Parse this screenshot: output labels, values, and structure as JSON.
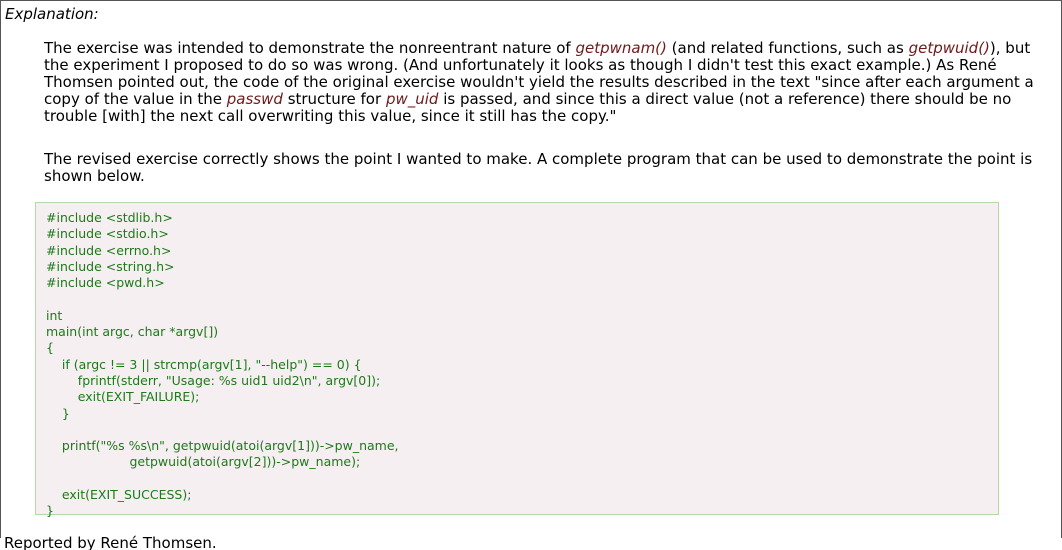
{
  "section_label": "Explanation:",
  "paragraph1": {
    "t1": "The exercise was intended to demonstrate the nonreentrant nature of ",
    "fn1": "getpwnam()",
    "t2": " (and related functions, such as ",
    "fn2": "getpwuid()",
    "t3": "), but the experiment I proposed to do so was wrong. (And unfortunately it looks as though I didn't test this exact example.) As René Thomsen pointed out, the code of the original exercise wouldn't yield the results described in the text \"since after each argument a copy of the value in the ",
    "fn3": "passwd",
    "t4": " structure for ",
    "fn4": "pw_uid",
    "t5": " is passed, and since this a direct value (not a reference) there should be no trouble [with] the next call overwriting this value, since it still has the copy.\""
  },
  "paragraph2": "The revised exercise correctly shows the point I wanted to make. A complete program that can be used to demonstrate the point is shown below.",
  "code": "#include <stdlib.h>\n#include <stdio.h>\n#include <errno.h>\n#include <string.h>\n#include <pwd.h>\n\nint\nmain(int argc, char *argv[])\n{\n    if (argc != 3 || strcmp(argv[1], \"--help\") == 0) {\n        fprintf(stderr, \"Usage: %s uid1 uid2\\n\", argv[0]);\n        exit(EXIT_FAILURE);\n    }\n\n    printf(\"%s %s\\n\", getpwuid(atoi(argv[1]))->pw_name,\n                     getpwuid(atoi(argv[2]))->pw_name);\n\n    exit(EXIT_SUCCESS);\n}",
  "reported_by": "Reported by René Thomsen."
}
